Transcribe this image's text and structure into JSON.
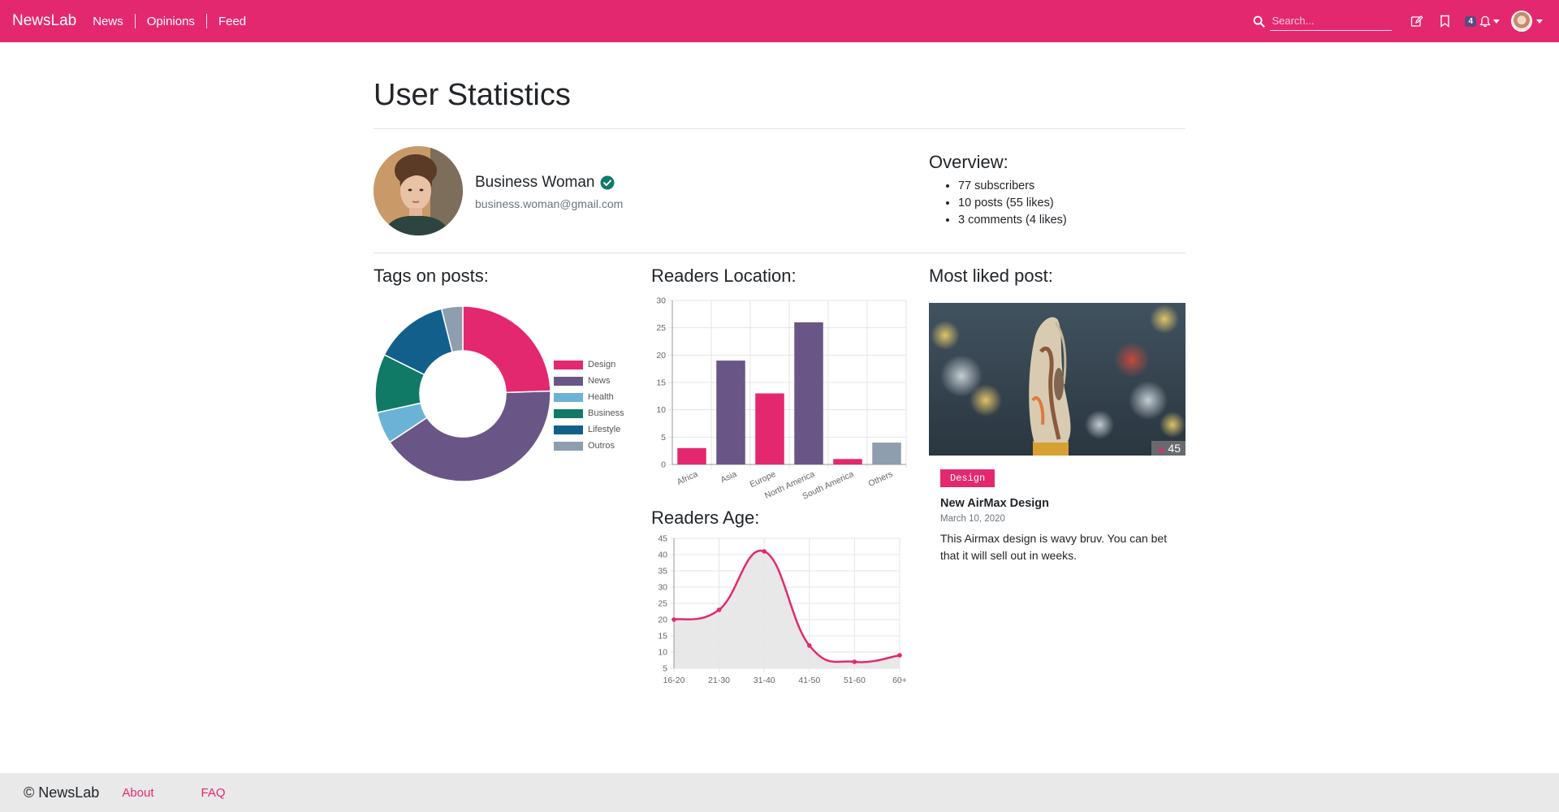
{
  "navbar": {
    "brand": "NewsLab",
    "links": [
      "News",
      "Opinions",
      "Feed"
    ],
    "search_placeholder": "Search...",
    "notification_count": "4"
  },
  "page": {
    "title": "User Statistics"
  },
  "profile": {
    "name": "Business Woman",
    "email": "business.woman@gmail.com"
  },
  "overview": {
    "title": "Overview:",
    "items": [
      "77 subscribers",
      "10 posts (55 likes)",
      "3 comments (4 likes)"
    ]
  },
  "sections": {
    "tags_title": "Tags on posts:",
    "location_title": "Readers Location:",
    "age_title": "Readers Age:",
    "liked_title": "Most liked post:"
  },
  "most_liked": {
    "likes": "45",
    "tag": "Design",
    "title": "New AirMax Design",
    "date": "March 10, 2020",
    "text": "This Airmax design is wavy bruv. You can bet that it will sell out in weeks."
  },
  "footer": {
    "brand": "© NewsLab",
    "links": [
      "About",
      "FAQ"
    ]
  },
  "colors": {
    "primary": "#e4286f",
    "purple": "#6a5686",
    "lightblue": "#6bb3d6",
    "green": "#107a66",
    "darkblue": "#135f8c",
    "gray": "#8e9eae"
  },
  "chart_data": [
    {
      "type": "pie",
      "title": "Tags on posts:",
      "categories": [
        "Design",
        "News",
        "Health",
        "Business",
        "Lifestyle",
        "Outros"
      ],
      "values": [
        25,
        42,
        6,
        11,
        14,
        4
      ],
      "colors": [
        "#e4286f",
        "#6a5686",
        "#6bb3d6",
        "#107a66",
        "#135f8c",
        "#8e9eae"
      ],
      "legend": "right"
    },
    {
      "type": "bar",
      "title": "Readers Location:",
      "categories": [
        "Africa",
        "Asia",
        "Europe",
        "North America",
        "South America",
        "Others"
      ],
      "values": [
        3,
        19,
        13,
        26,
        1,
        4
      ],
      "colors": [
        "#e4286f",
        "#6a5686",
        "#e4286f",
        "#6a5686",
        "#e4286f",
        "#8e9eae"
      ],
      "ylim": [
        0,
        30
      ],
      "yticks": [
        0,
        5,
        10,
        15,
        20,
        25,
        30
      ],
      "grid": true
    },
    {
      "type": "area",
      "title": "Readers Age:",
      "categories": [
        "16-20",
        "21-30",
        "31-40",
        "41-50",
        "51-60",
        "60+"
      ],
      "values": [
        20,
        23,
        41,
        12,
        7,
        9
      ],
      "ylim": [
        5,
        45
      ],
      "yticks": [
        5,
        10,
        15,
        20,
        25,
        30,
        35,
        40,
        45
      ],
      "grid": true,
      "line_color": "#e4286f",
      "fill_color": "#e6e6e6"
    }
  ]
}
